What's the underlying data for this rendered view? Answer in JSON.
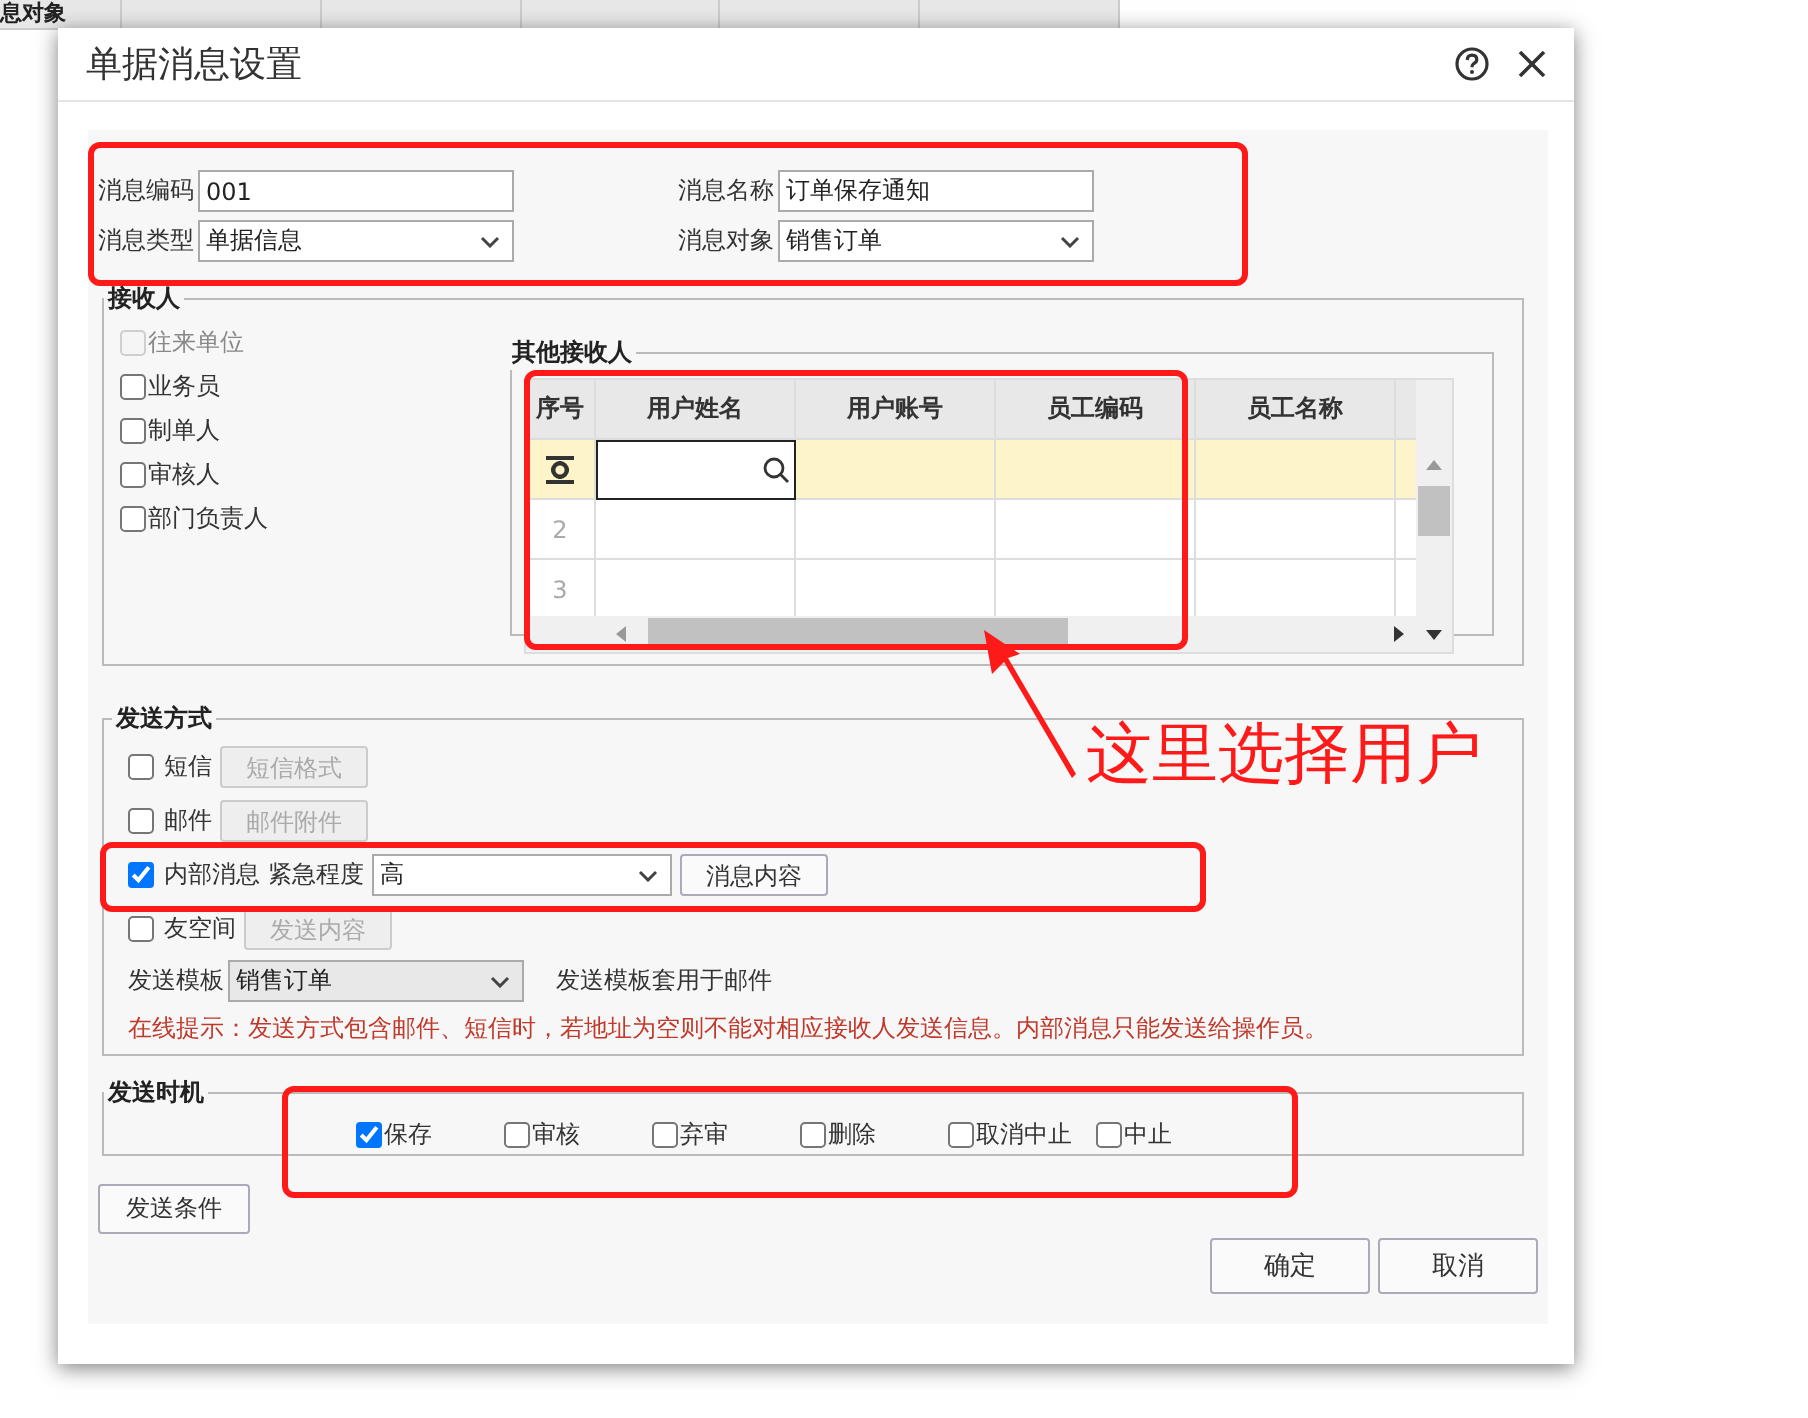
{
  "background_table": {
    "columns": [
      "息对象"
    ]
  },
  "dialog": {
    "title": "单据消息设置"
  },
  "fields": [
    {
      "label": "消息编码",
      "kind": "text",
      "value": "001"
    },
    {
      "label": "消息名称",
      "kind": "text",
      "value": "订单保存通知"
    },
    {
      "label": "消息类型",
      "kind": "select",
      "value": "单据信息"
    },
    {
      "label": "消息对象",
      "kind": "select",
      "value": "销售订单"
    }
  ],
  "recipients": {
    "title": "接收人",
    "options": [
      {
        "label": "往来单位",
        "checked": false,
        "disabled": true
      },
      {
        "label": "业务员",
        "checked": false,
        "disabled": false
      },
      {
        "label": "制单人",
        "checked": false,
        "disabled": false
      },
      {
        "label": "审核人",
        "checked": false,
        "disabled": false
      },
      {
        "label": "部门负责人",
        "checked": false,
        "disabled": false
      }
    ],
    "other": {
      "title": "其他接收人",
      "columns": [
        "序号",
        "用户姓名",
        "用户账号",
        "员工编码",
        "员工名称"
      ],
      "rows": [
        {
          "kind": "current"
        },
        {
          "kind": "plain",
          "number": "2"
        },
        {
          "kind": "plain",
          "number": "3"
        }
      ]
    }
  },
  "send_methods": {
    "title": "发送方式",
    "items": [
      {
        "kind": "button",
        "label": "短信",
        "checked": false,
        "button": "短信格式",
        "button_disabled": true
      },
      {
        "kind": "button",
        "label": "邮件",
        "checked": false,
        "button": "邮件附件",
        "button_disabled": true
      },
      {
        "kind": "urgency",
        "label": "内部消息",
        "checked": true,
        "urgency_label": "紧急程度",
        "urgency": "高",
        "button": "消息内容",
        "button_disabled": false
      },
      {
        "kind": "button",
        "label": "友空间",
        "checked": false,
        "button": "发送内容",
        "button_disabled": true
      }
    ],
    "template": {
      "label": "发送模板",
      "value": "销售订单",
      "note": "发送模板套用于邮件"
    },
    "hint": "在线提示：发送方式包含邮件、短信时，若地址为空则不能对相应接收人发送信息。内部消息只能发送给操作员。"
  },
  "timing": {
    "title": "发送时机",
    "options": [
      {
        "label": "保存",
        "checked": true
      },
      {
        "label": "审核",
        "checked": false
      },
      {
        "label": "弃审",
        "checked": false
      },
      {
        "label": "删除",
        "checked": false
      },
      {
        "label": "取消中止",
        "checked": false
      },
      {
        "label": "中止",
        "checked": false
      }
    ]
  },
  "condition_button": "发送条件",
  "buttons": [
    "确定",
    "取消"
  ],
  "annotation": {
    "text": "这里选择用户"
  }
}
